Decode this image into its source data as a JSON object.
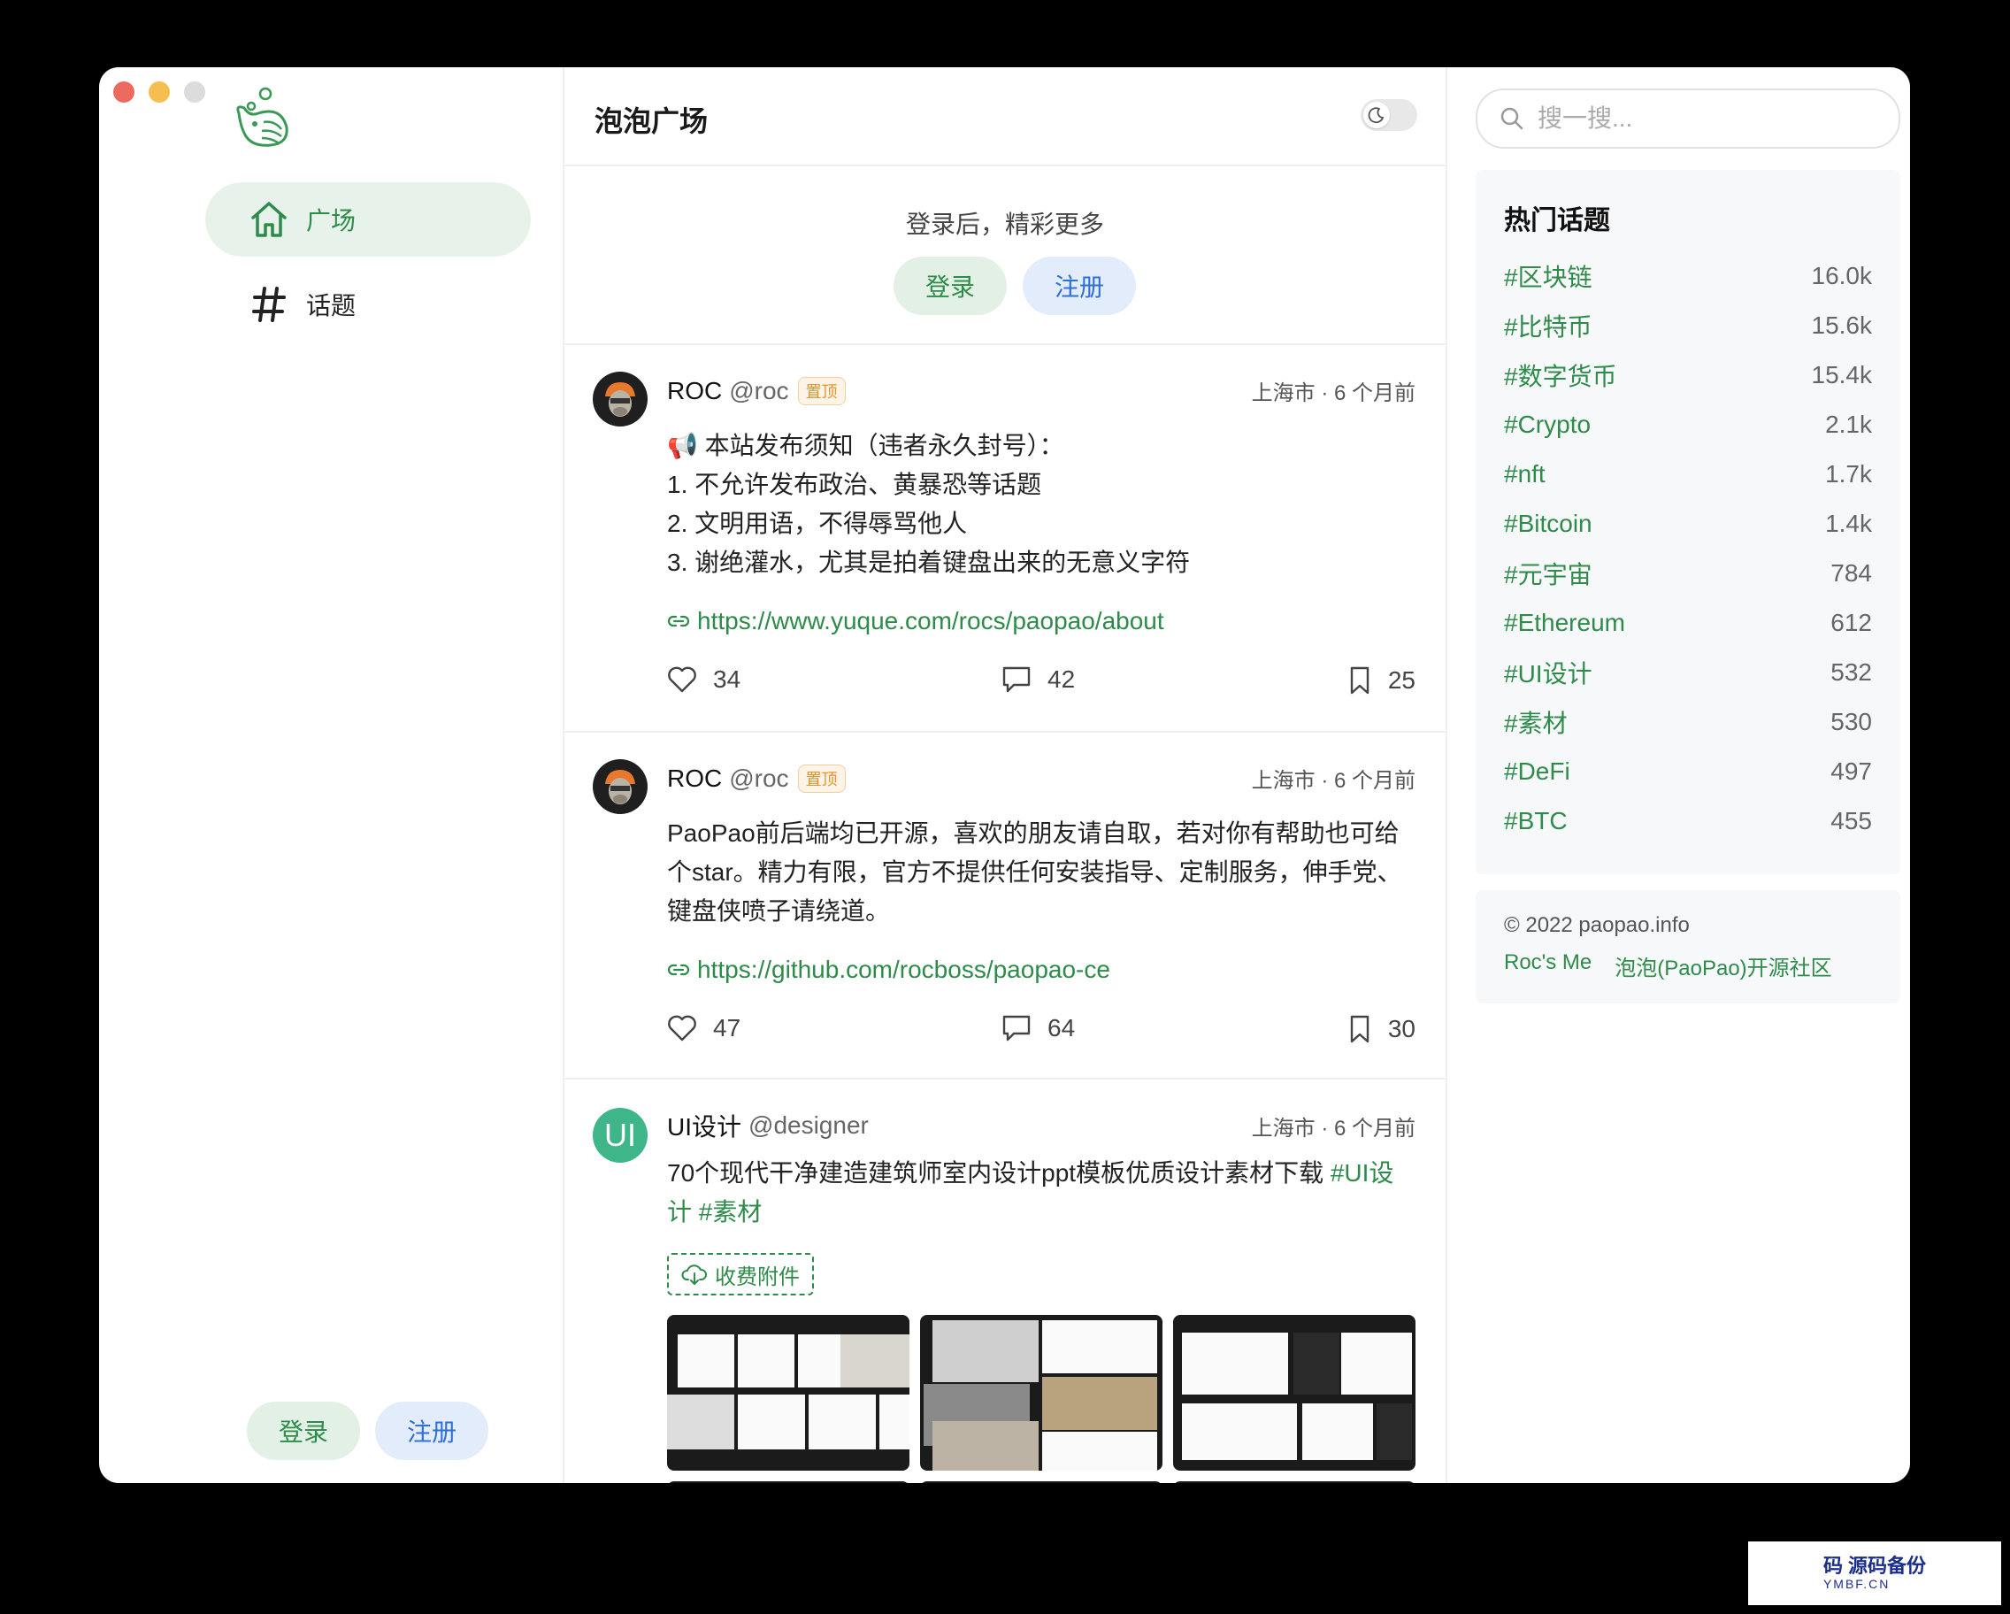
{
  "app": {
    "title": "泡泡广场"
  },
  "sidebar": {
    "nav": [
      {
        "label": "广场",
        "icon": "home-icon",
        "active": true
      },
      {
        "label": "话题",
        "icon": "hash-icon",
        "active": false
      }
    ],
    "login_label": "登录",
    "register_label": "注册"
  },
  "banner": {
    "text": "登录后，精彩更多",
    "login_label": "登录",
    "register_label": "注册"
  },
  "posts": [
    {
      "name": "ROC",
      "handle": "@roc",
      "badge": "置顶",
      "meta": "上海市 · 6 个月前",
      "lines": [
        "📢 本站发布须知（违者永久封号）：",
        "1. 不允许发布政治、黄暴恐等话题",
        "2. 文明用语，不得辱骂他人",
        "3. 谢绝灌水，尤其是拍着键盘出来的无意义字符"
      ],
      "link": "https://www.yuque.com/rocs/paopao/about",
      "likes": "34",
      "comments": "42",
      "collections": "25"
    },
    {
      "name": "ROC",
      "handle": "@roc",
      "badge": "置顶",
      "meta": "上海市 · 6 个月前",
      "lines": [
        "PaoPao前后端均已开源，喜欢的朋友请自取，若对你有帮助也可给",
        "个star。精力有限，官方不提供任何安装指导、定制服务，伸手党、",
        "键盘侠喷子请绕道。"
      ],
      "link": "https://github.com/rocboss/paopao-ce",
      "likes": "47",
      "comments": "64",
      "collections": "30"
    },
    {
      "name": "UI设计",
      "handle": "@designer",
      "avatar_text": "UI",
      "meta": "上海市 · 6 个月前",
      "text_line1": "70个现代干净建造建筑师室内设计ppt模板优质设计素材下载 ",
      "tag1a": "#UI设",
      "tag1b": "计",
      "tag2": "#素材",
      "attachment": "收费附件"
    }
  ],
  "search": {
    "placeholder": "搜一搜..."
  },
  "hot_topics": {
    "title": "热门话题",
    "items": [
      {
        "name": "#区块链",
        "count": "16.0k"
      },
      {
        "name": "#比特币",
        "count": "15.6k"
      },
      {
        "name": "#数字货币",
        "count": "15.4k"
      },
      {
        "name": "#Crypto",
        "count": "2.1k"
      },
      {
        "name": "#nft",
        "count": "1.7k"
      },
      {
        "name": "#Bitcoin",
        "count": "1.4k"
      },
      {
        "name": "#元宇宙",
        "count": "784"
      },
      {
        "name": "#Ethereum",
        "count": "612"
      },
      {
        "name": "#UI设计",
        "count": "532"
      },
      {
        "name": "#素材",
        "count": "530"
      },
      {
        "name": "#DeFi",
        "count": "497"
      },
      {
        "name": "#BTC",
        "count": "455"
      }
    ]
  },
  "footer": {
    "copyright": "© 2022 paopao.info",
    "links": [
      "Roc's Me",
      "泡泡(PaoPao)开源社区"
    ]
  },
  "watermark": {
    "title": "码 源码备份",
    "sub": "YMBF.CN"
  },
  "colors": {
    "accent": "#2e8b4a",
    "register": "#2f6fd6",
    "badge": "#e8922e"
  }
}
